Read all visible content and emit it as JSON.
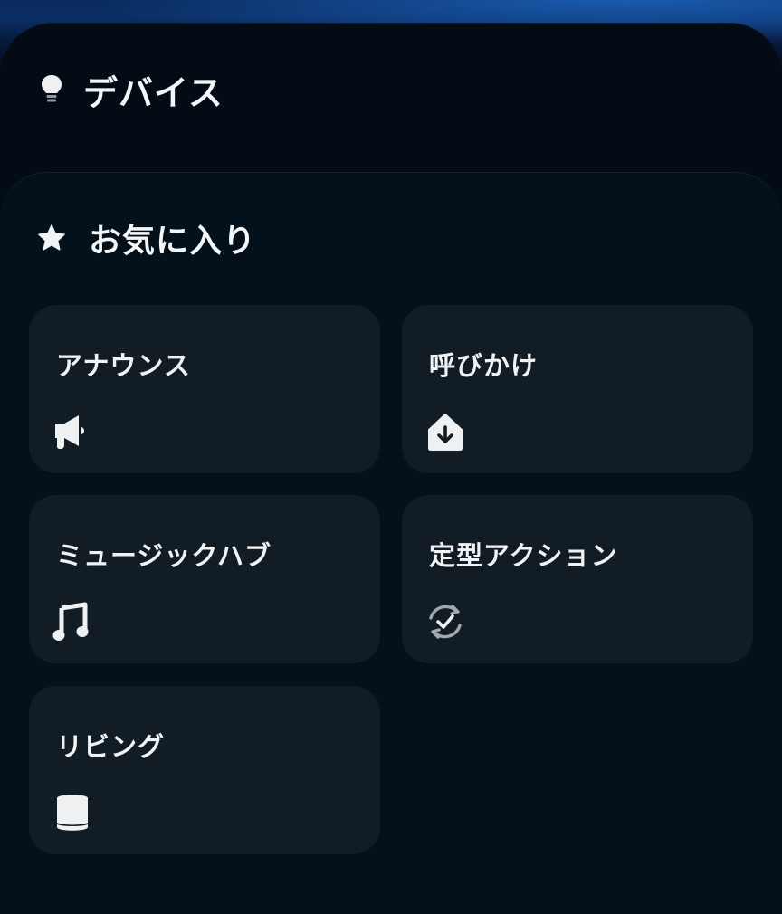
{
  "devices": {
    "title": "デバイス",
    "icon": "lightbulb-icon"
  },
  "favorites": {
    "title": "お気に入り",
    "icon": "star-icon",
    "cards": [
      {
        "label": "アナウンス",
        "icon": "megaphone-icon"
      },
      {
        "label": "呼びかけ",
        "icon": "drop-in-house-icon"
      },
      {
        "label": "ミュージックハブ",
        "icon": "music-note-icon"
      },
      {
        "label": "定型アクション",
        "icon": "routine-check-icon"
      },
      {
        "label": "リビング",
        "icon": "echo-speaker-icon"
      }
    ]
  },
  "colors": {
    "background": "#030b14",
    "card": "#121c24",
    "text": "#f0f2f4",
    "accent_blue": "#0b2f66"
  }
}
